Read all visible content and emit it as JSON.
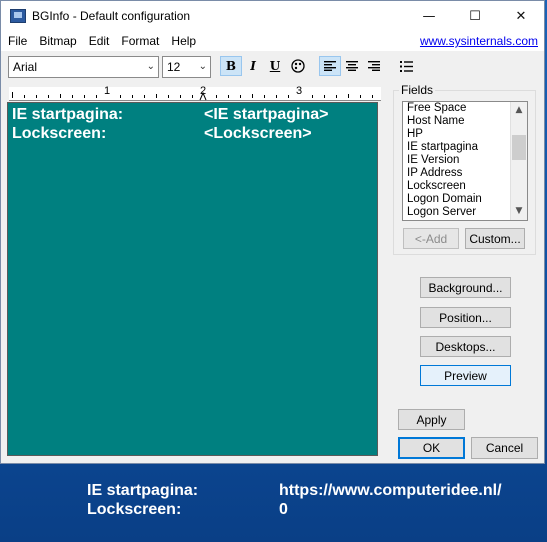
{
  "window": {
    "title": "BGInfo - Default configuration",
    "buttons": {
      "minimize": "—",
      "maximize": "☐",
      "close": "✕"
    }
  },
  "menu": [
    "File",
    "Bitmap",
    "Edit",
    "Format",
    "Help"
  ],
  "link": "www.sysinternals.com",
  "toolbar": {
    "font": "Arial",
    "size": "12",
    "bold": "B",
    "italic": "I",
    "underline": "U"
  },
  "ruler": {
    "numbers": [
      "1",
      "2",
      "3"
    ]
  },
  "editor": {
    "lines": [
      {
        "label": "IE startpagina:",
        "value": "<IE startpagina>"
      },
      {
        "label": "Lockscreen:",
        "value": "<Lockscreen>"
      }
    ],
    "background_color": "#008080"
  },
  "fields": {
    "legend": "Fields",
    "items": [
      "Free Space",
      "Host Name",
      "HP",
      "IE startpagina",
      "IE Version",
      "IP Address",
      "Lockscreen",
      "Logon Domain",
      "Logon Server"
    ],
    "add_button": "<-Add",
    "custom_button": "Custom..."
  },
  "buttons": {
    "background": "Background...",
    "position": "Position...",
    "desktops": "Desktops...",
    "preview": "Preview",
    "apply": "Apply",
    "ok": "OK",
    "cancel": "Cancel"
  },
  "desktop_preview": [
    {
      "label": "IE startpagina:",
      "value": "https://www.computeridee.nl/"
    },
    {
      "label": "Lockscreen:",
      "value": "0"
    }
  ],
  "colors": {
    "accent": "#0078d7",
    "desktop": "#1a5fb0"
  }
}
